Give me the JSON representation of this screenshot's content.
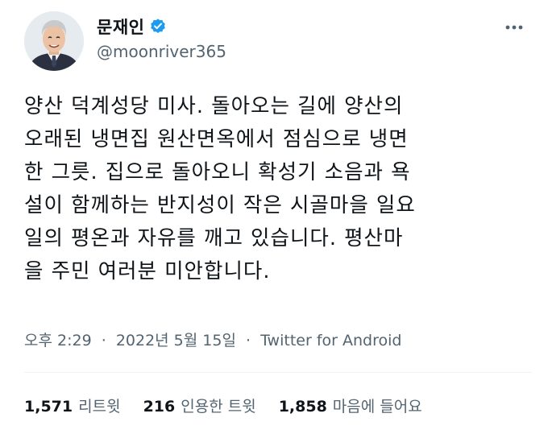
{
  "author": {
    "display_name": "문재인",
    "handle": "@moonriver365",
    "verified": true
  },
  "tweet": {
    "lines": [
      "양산 덕계성당 미사. 돌아오는 길에 양산의",
      "오래된 냉면집 원산면옥에서 점심으로 냉면",
      "한 그릇. 집으로 돌아오니 확성기 소음과 욕",
      "설이 함께하는 반지성이 작은 시골마을 일요",
      "일의 평온과 자유를 깨고 있습니다. 평산마",
      "을 주민 여러분 미안합니다."
    ],
    "time": "오후 2:29",
    "date": "2022년 5월 15일",
    "separator": "·",
    "source": "Twitter for Android"
  },
  "stats": {
    "retweets": {
      "count": "1,571",
      "label": "리트윗"
    },
    "quotes": {
      "count": "216",
      "label": "인용한 트윗"
    },
    "likes": {
      "count": "1,858",
      "label": "마음에 들어요"
    }
  },
  "icons": {
    "verified": "verified-badge-icon",
    "more": "more-options-icon"
  },
  "colors": {
    "verified_blue": "#1d9bf0",
    "secondary_text": "#536471",
    "primary_text": "#0f1419",
    "divider": "#eff3f4"
  }
}
